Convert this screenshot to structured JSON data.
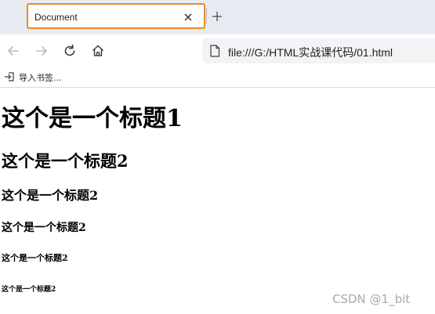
{
  "tab": {
    "title": "Document"
  },
  "toolbar": {
    "address": "file:///G:/HTML实战课代码/01.html"
  },
  "bookmarks_bar": {
    "import_label": "导入书签..."
  },
  "page": {
    "headings": [
      "这个是一个标题1",
      "这个是一个标题2",
      "这个是一个标题2",
      "这个是一个标题2",
      "这个是一个标题2",
      "这个是一个标题2"
    ]
  },
  "watermark": "CSDN @1_bit",
  "colors": {
    "tab_highlight": "#e8892b",
    "tabstrip_bg": "#e7ecf3",
    "address_bg": "#f1f3f4"
  }
}
